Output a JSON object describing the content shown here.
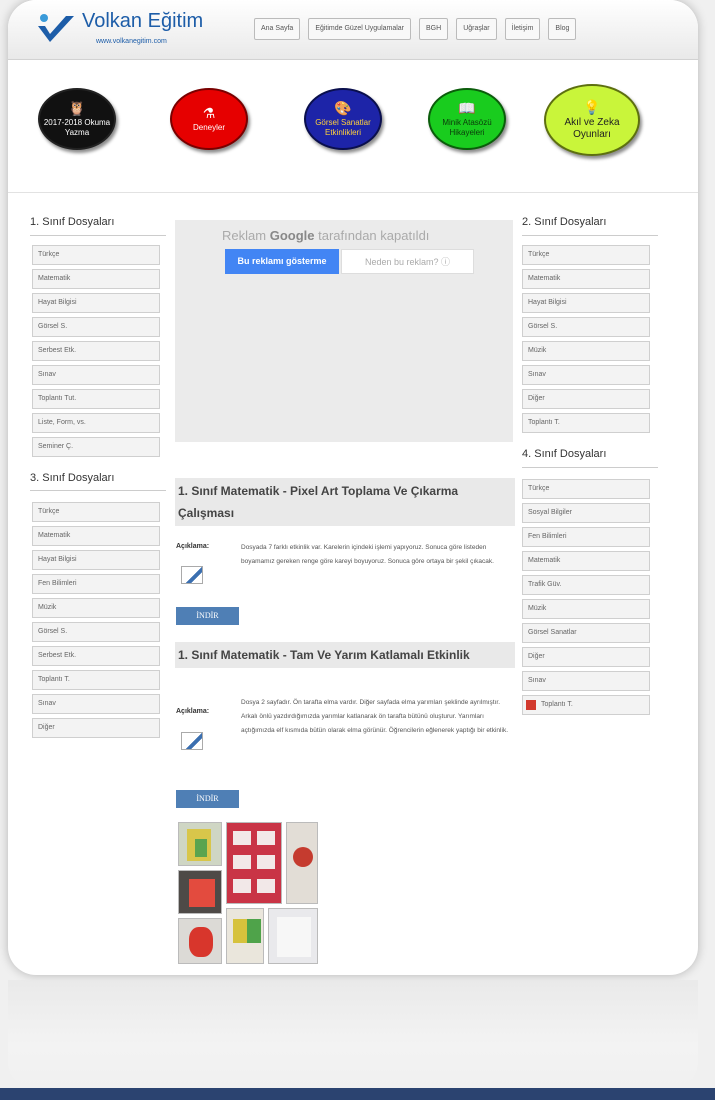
{
  "header": {
    "logo_title": "Volkan Eğitim",
    "logo_sub": "www.volkanegitim.com",
    "nav": [
      "Ana Sayfa",
      "Eğitimde Güzel Uygulamalar",
      "BGH",
      "Uğraşlar",
      "İletişim",
      "Blog"
    ]
  },
  "circles": [
    {
      "label": "2017-2018 Okuma Yazma",
      "icon": "owl-icon",
      "glyph": "🦉"
    },
    {
      "label": "Deneyler",
      "icon": "flask-icon",
      "glyph": "⚗"
    },
    {
      "label": "Görsel Sanatlar Etkinlikleri",
      "icon": "palette-icon",
      "glyph": "🎨"
    },
    {
      "label": "Minik Atasözü Hikayeleri",
      "icon": "book-icon",
      "glyph": "📖"
    },
    {
      "label": "Akıl ve Zeka Oyunları",
      "icon": "lightbulb-icon",
      "glyph": "💡"
    }
  ],
  "left": {
    "title1": "1. Sınıf Dosyaları",
    "items1": [
      "Türkçe",
      "Matematik",
      "Hayat Bilgisi",
      "Görsel S.",
      "Serbest Etk.",
      "Sınav",
      "Toplantı Tut.",
      "Liste, Form, vs.",
      "Seminer Ç."
    ],
    "title3": "3. Sınıf Dosyaları",
    "items3": [
      "Türkçe",
      "Matematik",
      "Hayat Bilgisi",
      "Fen Bilimleri",
      "Müzik",
      "Görsel S.",
      "Serbest Etk.",
      "Toplantı T.",
      "Sınav",
      "Diğer"
    ]
  },
  "right": {
    "title2": "2. Sınıf Dosyaları",
    "items2": [
      "Türkçe",
      "Matematik",
      "Hayat Bilgisi",
      "Görsel S.",
      "Müzik",
      "Sınav",
      "Diğer",
      "Toplantı T."
    ],
    "title4": "4. Sınıf Dosyaları",
    "items4": [
      "Türkçe",
      "Sosyal Bilgiler",
      "Fen Bilimleri",
      "Matematik",
      "Trafik Güv.",
      "Müzik",
      "Görsel Sanatlar",
      "Diğer",
      "Sınav",
      "Toplantı T."
    ]
  },
  "ad": {
    "prefix": "Reklam",
    "brand": "Google",
    "suffix": "tarafından kapatıldı",
    "show_button": "Bu reklamı gösterme",
    "why_button": "Neden bu reklam? ⓘ"
  },
  "posts": [
    {
      "title": "1. Sınıf Matematik - Pixel Art Toplama Ve Çıkarma Çalışması",
      "label": "Açıklama:",
      "desc": "Dosyada 7 farklı etkinlik var. Karelerin içindeki işlemi yapıyoruz. Sonuca göre listeden boyamamız gereken renge göre kareyi boyuyoruz. Sonuca göre ortaya bir şekil çıkacak.",
      "download": "İNDİR"
    },
    {
      "title": "1. Sınıf Matematik - Tam Ve Yarım Katlamalı Etkinlik",
      "label": "Açıklama:",
      "desc": "Dosya 2 sayfadır. Ön tarafta elma vardır. Diğer sayfada elma yarımları şeklinde ayrılmıştır. Arkalı önlü yazdırdığımızda yarımlar katlanarak ön tarafta bütünü oluşturur. Yarımları açtığımızda elf kısmıda bütün olarak elma görünür. Öğrencilerin eğlenerek yaptığı bir etkinlik.",
      "download": "İNDİR"
    }
  ],
  "colors": {
    "accent": "#1d5da8",
    "download": "#4f7fb5",
    "footer": "#2b4370"
  }
}
